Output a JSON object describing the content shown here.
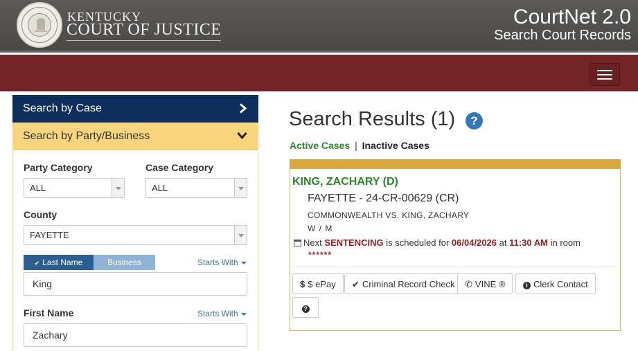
{
  "header": {
    "brand_top": "KENTUCKY",
    "brand_main": "COURT OF JUSTICE",
    "app_title": "CourtNet 2.0",
    "app_subtitle": "Search Court Records"
  },
  "sidebar": {
    "search_by_case": "Search by Case",
    "search_by_party": "Search by Party/Business",
    "party_category_label": "Party Category",
    "party_category_value": "ALL",
    "case_category_label": "Case Category",
    "case_category_value": "ALL",
    "county_label": "County",
    "county_value": "FAYETTE",
    "toggle_last_name": "Last Name",
    "toggle_business": "Business",
    "starts_with_1": "Starts With",
    "last_name_value": "King",
    "first_name_label": "First Name",
    "starts_with_2": "Starts With",
    "first_name_value": "Zachary"
  },
  "main": {
    "results_title": "Search Results (1)",
    "help_glyph": "?",
    "active_cases": "Active Cases",
    "separator": "|",
    "inactive_cases": "Inactive Cases",
    "result": {
      "party_name": "KING, ZACHARY (D)",
      "case_number": "FAYETTE - 24-CR-00629  (CR)",
      "case_style": "COMMONWEALTH VS. KING, ZACHARY",
      "race_sex": "W / M",
      "next_prefix": "Next",
      "event": "SENTENCING",
      "scheduled_for": "is scheduled for",
      "date": "06/04/2026",
      "at": "at",
      "time": "11:30 AM",
      "in_room": "in room",
      "room": "******"
    },
    "buttons": {
      "epay": "$ ePay",
      "criminal_record_check": "Criminal Record Check",
      "vine": "VINE ®",
      "clerk_contact": "Clerk Contact",
      "help": "?"
    }
  },
  "colors": {
    "header_bg": "#4f4e4a",
    "nav_bg": "#722426",
    "case_tab_bg": "#0e2f5b",
    "party_tab_bg": "#f9d67e",
    "accent_green": "#2a8a2a",
    "accent_red": "#a31c1c",
    "card_border": "#d8a93d"
  },
  "icons": {
    "seal": "kentucky-seal-icon",
    "menu": "hamburger-icon",
    "case_chevron": "chevron-right-icon",
    "party_chevron": "chevron-down-icon",
    "help": "question-circle-icon",
    "calendar": "calendar-icon",
    "epay": "dollar-icon",
    "crc": "check-icon",
    "vine": "phone-icon",
    "clerk": "info-circle-icon"
  }
}
